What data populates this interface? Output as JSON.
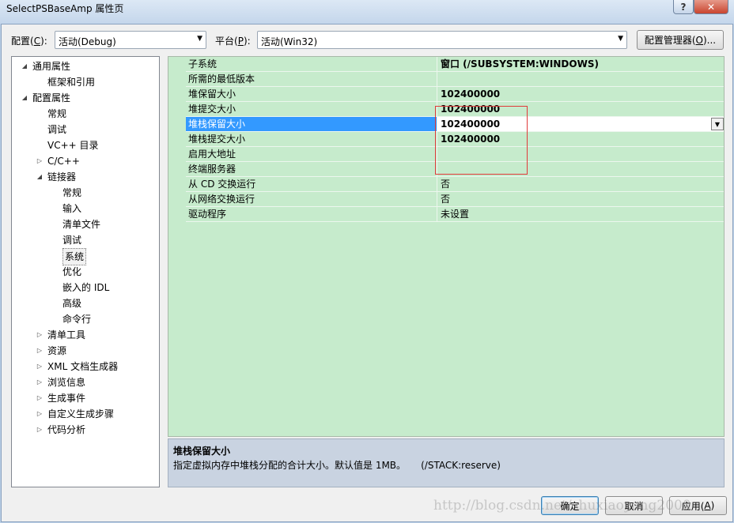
{
  "window": {
    "title": "SelectPSBaseAmp 属性页",
    "help_label": "?",
    "close_label": "✕"
  },
  "toolbar": {
    "config_label": "配置(",
    "config_key": "C",
    "config_suffix": "):",
    "config_value": "活动(Debug)",
    "platform_label": "平台(",
    "platform_key": "P",
    "platform_suffix": "):",
    "platform_value": "活动(Win32)",
    "manager_label": "配置管理器(",
    "manager_key": "O",
    "manager_suffix": ")..."
  },
  "tree": [
    {
      "label": "通用属性",
      "toggle": "expanded"
    },
    {
      "label": "框架和引用",
      "toggle": ""
    },
    {
      "label": "配置属性",
      "toggle": "expanded"
    },
    {
      "label": "常规",
      "toggle": ""
    },
    {
      "label": "调试",
      "toggle": ""
    },
    {
      "label": "VC++ 目录",
      "toggle": ""
    },
    {
      "label": "C/C++",
      "toggle": "collapsed"
    },
    {
      "label": "链接器",
      "toggle": "expanded"
    },
    {
      "label": "常规",
      "toggle": ""
    },
    {
      "label": "输入",
      "toggle": ""
    },
    {
      "label": "清单文件",
      "toggle": ""
    },
    {
      "label": "调试",
      "toggle": ""
    },
    {
      "label": "系统",
      "toggle": ""
    },
    {
      "label": "优化",
      "toggle": ""
    },
    {
      "label": "嵌入的 IDL",
      "toggle": ""
    },
    {
      "label": "高级",
      "toggle": ""
    },
    {
      "label": "命令行",
      "toggle": ""
    },
    {
      "label": "清单工具",
      "toggle": "collapsed"
    },
    {
      "label": "资源",
      "toggle": "collapsed"
    },
    {
      "label": "XML 文档生成器",
      "toggle": "collapsed"
    },
    {
      "label": "浏览信息",
      "toggle": "collapsed"
    },
    {
      "label": "生成事件",
      "toggle": "collapsed"
    },
    {
      "label": "自定义生成步骤",
      "toggle": "collapsed"
    },
    {
      "label": "代码分析",
      "toggle": "collapsed"
    }
  ],
  "properties": [
    {
      "name": "子系统",
      "value": "窗口 (/SUBSYSTEM:WINDOWS)",
      "bold": true
    },
    {
      "name": "所需的最低版本",
      "value": "",
      "bold": false
    },
    {
      "name": "堆保留大小",
      "value": "102400000",
      "bold": true
    },
    {
      "name": "堆提交大小",
      "value": "102400000",
      "bold": true
    },
    {
      "name": "堆栈保留大小",
      "value": "102400000",
      "bold": true
    },
    {
      "name": "堆栈提交大小",
      "value": "102400000",
      "bold": true
    },
    {
      "name": "启用大地址",
      "value": "",
      "bold": false
    },
    {
      "name": "终端服务器",
      "value": "",
      "bold": false
    },
    {
      "name": "从 CD 交换运行",
      "value": "否",
      "bold": false
    },
    {
      "name": "从网络交换运行",
      "value": "否",
      "bold": false
    },
    {
      "name": "驱动程序",
      "value": "未设置",
      "bold": false
    }
  ],
  "description": {
    "title": "堆栈保留大小",
    "text": "指定虚拟内存中堆栈分配的合计大小。默认值是 1MB。     (/STACK:reserve)"
  },
  "buttons": {
    "ok": "确定",
    "cancel": "取消",
    "apply_label": "应用(",
    "apply_key": "A",
    "apply_suffix": ")"
  },
  "watermark": "http://blog.csdn.net/zhuxiaoyang2000",
  "colors": {
    "grid_bg": "#c6ebcc",
    "selection": "#3399ff",
    "highlight_box": "#e03a3a"
  }
}
